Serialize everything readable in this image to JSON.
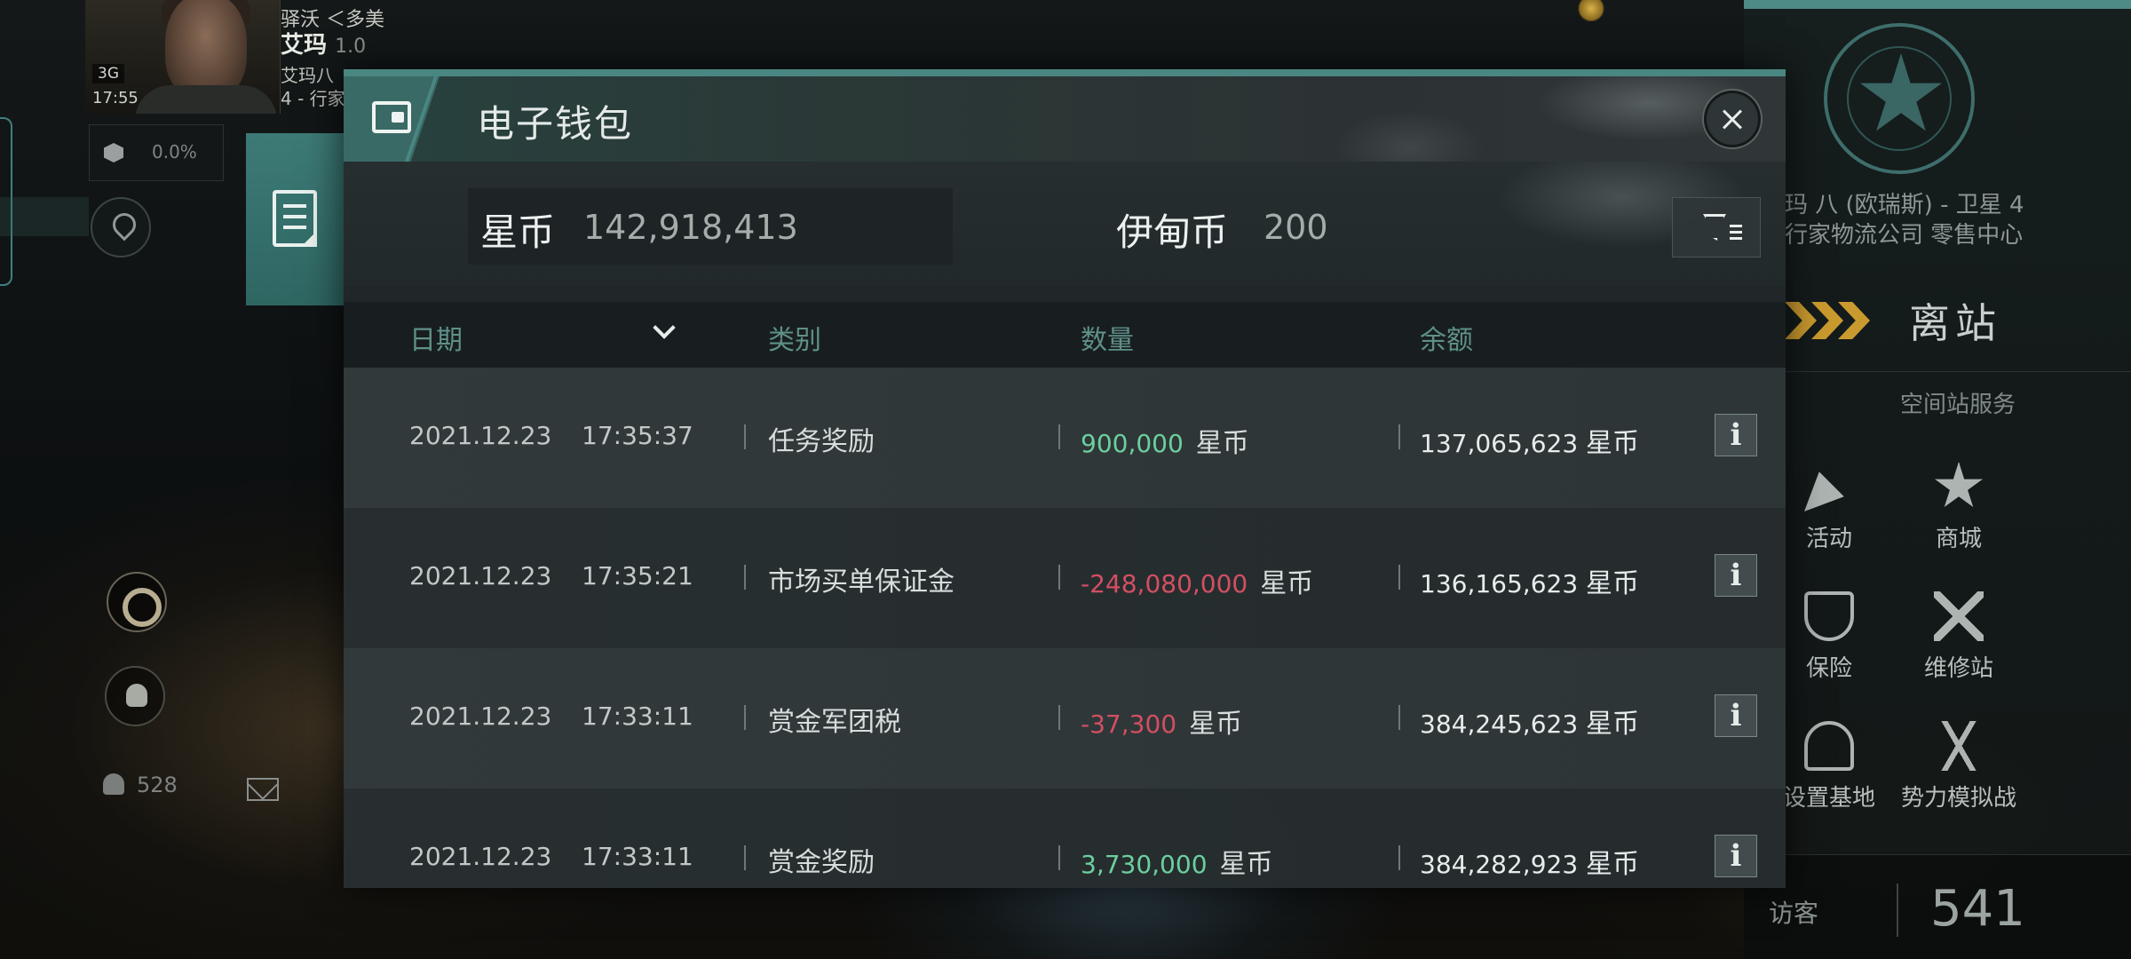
{
  "hud": {
    "signal": "3G",
    "time": "17:55",
    "system_line1": "驿沃 ＜多美",
    "system_name": "艾玛",
    "security": "1.0",
    "station_short_line1": "艾玛八",
    "station_short_line2": "4 - 行家",
    "cargo_percent": "0.0%",
    "online_count": "528"
  },
  "wallet": {
    "title": "电子钱包",
    "star_coin_label": "星币",
    "star_coin_value": "142,918,413",
    "isk_label": "伊甸币",
    "isk_value": "200",
    "columns": {
      "date": "日期",
      "category": "类别",
      "amount": "数量",
      "balance": "余额"
    },
    "currency_unit": "星币",
    "transactions": [
      {
        "date": "2021.12.23",
        "time": "17:35:37",
        "category": "任务奖励",
        "amount": "900,000",
        "amount_unit": "星币",
        "balance": "137,065,623",
        "balance_unit": "星币",
        "sign": "positive"
      },
      {
        "date": "2021.12.23",
        "time": "17:35:21",
        "category": "市场买单保证金",
        "amount": "-248,080,000",
        "amount_unit": "星币",
        "balance": "136,165,623",
        "balance_unit": "星币",
        "sign": "negative"
      },
      {
        "date": "2021.12.23",
        "time": "17:33:11",
        "category": "赏金军团税",
        "amount": "-37,300",
        "amount_unit": "星币",
        "balance": "384,245,623",
        "balance_unit": "星币",
        "sign": "negative"
      },
      {
        "date": "2021.12.23",
        "time": "17:33:11",
        "category": "赏金奖励",
        "amount": "3,730,000",
        "amount_unit": "星币",
        "balance": "384,282,923",
        "balance_unit": "星币",
        "sign": "positive"
      }
    ],
    "info_glyph": "i"
  },
  "station": {
    "name_line1": "玛 八 (欧瑞斯) - 卫星 4",
    "name_line2": "行家物流公司 零售中心",
    "undock_label": "离站",
    "services_title": "空间站服务",
    "services": [
      {
        "label": "活动",
        "icon": "party-popper-icon"
      },
      {
        "label": "商城",
        "icon": "shop-star-icon"
      },
      {
        "label": "保险",
        "icon": "insurance-shield-icon"
      },
      {
        "label": "维修站",
        "icon": "repair-wrench-icon"
      },
      {
        "label": "设置基地",
        "icon": "base-icon"
      },
      {
        "label": "势力模拟战",
        "icon": "crossed-flags-icon"
      }
    ],
    "visitors_label": "访客",
    "visitors_count": "541"
  },
  "colors": {
    "accent": "#4a8682",
    "positive": "#6ccf9d",
    "negative": "#d24f62",
    "header_text": "#5f9088",
    "undock_chevron": "#c99a2e"
  }
}
